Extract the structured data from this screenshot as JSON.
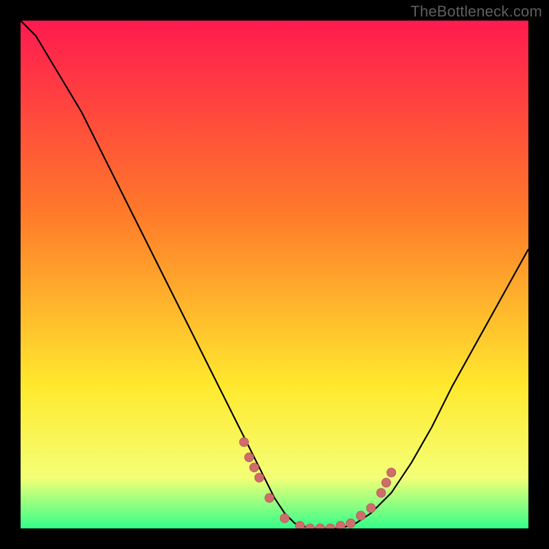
{
  "watermark": "TheBottleneck.com",
  "colors": {
    "bg": "#000000",
    "curve": "#000000",
    "marker_fill": "#cf6d6d",
    "marker_stroke": "#b95b5b",
    "gradient_top": "#ff1a4f",
    "gradient_mid1": "#ff7a2a",
    "gradient_mid2": "#ffe92e",
    "gradient_mid3": "#f4ff76",
    "gradient_bottom": "#34ff8a"
  },
  "chart_data": {
    "type": "line",
    "title": "",
    "xlabel": "",
    "ylabel": "",
    "xlim": [
      0,
      100
    ],
    "ylim": [
      0,
      100
    ],
    "series": [
      {
        "name": "bottleneck-curve",
        "x": [
          0,
          3,
          6,
          9,
          12,
          15,
          18,
          22,
          26,
          30,
          34,
          38,
          42,
          46,
          48,
          50,
          52,
          54,
          57,
          60,
          63,
          66,
          69,
          73,
          77,
          81,
          85,
          90,
          95,
          100
        ],
        "y": [
          100,
          97,
          92,
          87,
          82,
          76,
          70,
          62,
          54,
          46,
          38,
          30,
          22,
          14,
          10,
          6,
          3,
          1,
          0,
          0,
          0,
          1,
          3,
          7,
          13,
          20,
          28,
          37,
          46,
          55
        ]
      }
    ],
    "markers": {
      "name": "data-points",
      "x": [
        44,
        45,
        46,
        47,
        49,
        52,
        55,
        57,
        59,
        61,
        63,
        65,
        67,
        69,
        71,
        72,
        73
      ],
      "y": [
        17,
        14,
        12,
        10,
        6,
        2,
        0.5,
        0,
        0,
        0,
        0.5,
        1,
        2.5,
        4,
        7,
        9,
        11
      ]
    }
  }
}
